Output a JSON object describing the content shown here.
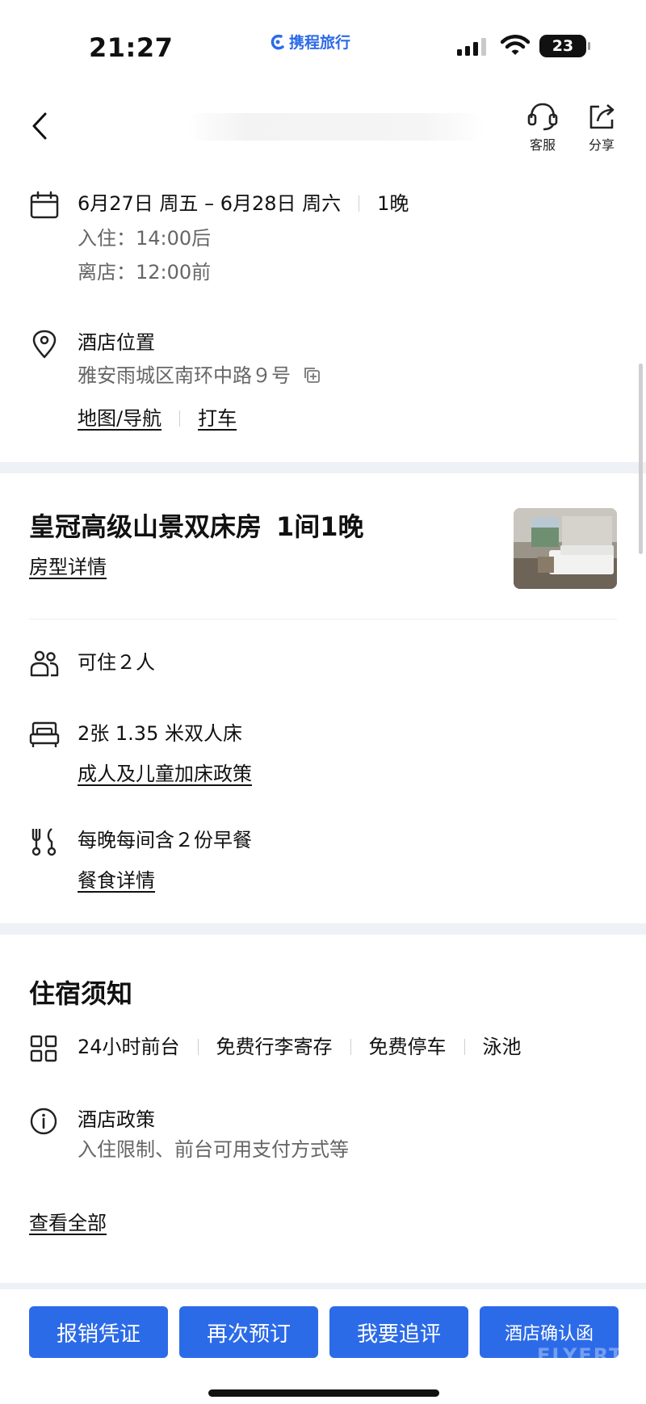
{
  "status_bar": {
    "time": "21:27",
    "brand": "携程旅行",
    "battery": "23"
  },
  "nav": {
    "service_label": "客服",
    "share_label": "分享"
  },
  "stay": {
    "dates": "6月27日 周五 – 6月28日 周六",
    "nights": "1晚",
    "checkin": "入住：14:00后",
    "checkout": "离店：12:00前"
  },
  "location": {
    "title": "酒店位置",
    "address": "雅安雨城区南环中路９号",
    "map_link": "地图/导航",
    "taxi_link": "打车"
  },
  "room": {
    "name": "皇冠高级山景双床房",
    "count": "1间1晚",
    "details_link": "房型详情",
    "occupancy": "可住２人",
    "beds": "2张 1.35 米双人床",
    "bed_policy_link": "成人及儿童加床政策",
    "breakfast": "每晚每间含２份早餐",
    "meal_link": "餐食详情"
  },
  "notice": {
    "title": "住宿须知",
    "facilities": [
      "24小时前台",
      "免费行李寄存",
      "免费停车",
      "泳池"
    ],
    "policy_title": "酒店政策",
    "policy_desc": "入住限制、前台可用支付方式等",
    "view_all": "查看全部"
  },
  "actions": {
    "receipt": "报销凭证",
    "rebook": "再次预订",
    "review": "我要追评",
    "confirmation": "酒店确认函"
  },
  "watermark": "FLYERT",
  "colors": {
    "accent": "#2c6be8",
    "band": "#eef1f5",
    "secondary_text": "#666666"
  }
}
